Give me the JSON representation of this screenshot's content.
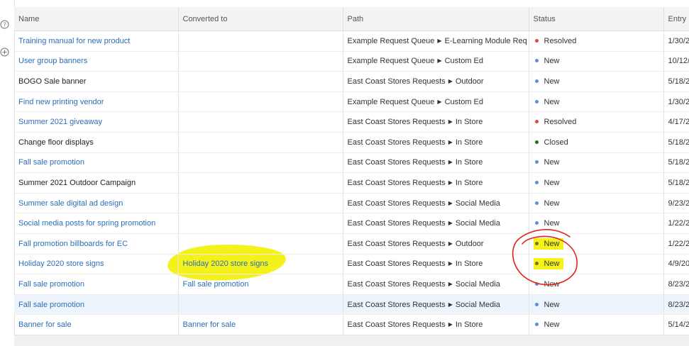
{
  "columns": {
    "name": "Name",
    "converted": "Converted to",
    "path": "Path",
    "status": "Status",
    "entry": "Entry"
  },
  "rows": [
    {
      "name": "Training manual for new product",
      "converted": "",
      "path_a": "Example Request Queue",
      "path_b": "E-Learning Module Req",
      "status": "Resolved",
      "entry": "1/30/2"
    },
    {
      "name": "User group banners",
      "converted": "",
      "path_a": "Example Request Queue",
      "path_b": "Custom Ed",
      "status": "New",
      "entry": "10/12/2"
    },
    {
      "name": "BOGO Sale banner",
      "converted": "",
      "path_a": "East Coast Stores Requests",
      "path_b": "Outdoor",
      "status": "New",
      "entry": "5/18/2"
    },
    {
      "name": "Find new printing vendor",
      "converted": "",
      "path_a": "Example Request Queue",
      "path_b": "Custom Ed",
      "status": "New",
      "entry": "1/30/2"
    },
    {
      "name": "Summer 2021 giveaway",
      "converted": "",
      "path_a": "East Coast Stores Requests",
      "path_b": "In Store",
      "status": "Resolved",
      "entry": "4/17/2"
    },
    {
      "name": "Change floor displays",
      "converted": "",
      "path_a": "East Coast Stores Requests",
      "path_b": "In Store",
      "status": "Closed",
      "entry": "5/18/2"
    },
    {
      "name": "Fall sale promotion",
      "converted": "",
      "path_a": "East Coast Stores Requests",
      "path_b": "In Store",
      "status": "New",
      "entry": "5/18/2"
    },
    {
      "name": "Summer 2021 Outdoor Campaign",
      "converted": "",
      "path_a": "East Coast Stores Requests",
      "path_b": "In Store",
      "status": "New",
      "entry": "5/18/2"
    },
    {
      "name": "Summer sale digital ad design",
      "converted": "",
      "path_a": "East Coast Stores Requests",
      "path_b": "Social Media",
      "status": "New",
      "entry": "9/23/2"
    },
    {
      "name": "Social media posts for spring promotion",
      "converted": "",
      "path_a": "East Coast Stores Requests",
      "path_b": "Social Media",
      "status": "New",
      "entry": "1/22/2"
    },
    {
      "name": "Fall promotion billboards for EC",
      "converted": "",
      "path_a": "East Coast Stores Requests",
      "path_b": "Outdoor",
      "status": "New",
      "entry": "1/22/2"
    },
    {
      "name": "Holiday 2020 store signs",
      "converted": "Holiday 2020 store signs",
      "path_a": "East Coast Stores Requests",
      "path_b": "In Store",
      "status": "New",
      "entry": "4/9/20"
    },
    {
      "name": "Fall sale promotion",
      "converted": "Fall sale promotion",
      "path_a": "East Coast Stores Requests",
      "path_b": "Social Media",
      "status": "New",
      "entry": "8/23/2"
    },
    {
      "name": "Fall sale promotion",
      "converted": "",
      "path_a": "East Coast Stores Requests",
      "path_b": "Social Media",
      "status": "New",
      "entry": "8/23/2"
    },
    {
      "name": "Banner for sale",
      "converted": "Banner for sale",
      "path_a": "East Coast Stores Requests",
      "path_b": "In Store",
      "status": "New",
      "entry": "5/14/2"
    }
  ],
  "row_meta": [
    {
      "linked": true,
      "dot_color": "#e04646"
    },
    {
      "linked": true,
      "dot_color": "#5b8fdb"
    },
    {
      "linked": false,
      "dot_color": "#5b8fdb"
    },
    {
      "linked": true,
      "dot_color": "#5b8fdb"
    },
    {
      "linked": true,
      "dot_color": "#e04646"
    },
    {
      "linked": false,
      "dot_color": "#1e6b1e"
    },
    {
      "linked": true,
      "dot_color": "#5b8fdb"
    },
    {
      "linked": false,
      "dot_color": "#5b8fdb"
    },
    {
      "linked": true,
      "dot_color": "#5b8fdb"
    },
    {
      "linked": true,
      "dot_color": "#5b8fdb"
    },
    {
      "linked": true,
      "dot_color": "#6b7a1e",
      "highlight_status": true
    },
    {
      "linked": true,
      "dot_color": "#6b7a1e",
      "highlight_status": true,
      "highlight_converted": true
    },
    {
      "linked": true,
      "dot_color": "#5b8fdb"
    },
    {
      "linked": true,
      "dot_color": "#5b8fdb",
      "selected": true
    },
    {
      "linked": true,
      "dot_color": "#5b8fdb"
    }
  ],
  "rail_icons": [
    "question-icon",
    "add-icon"
  ],
  "colors": {
    "link": "#2a6ebb",
    "highlighter": "#f4f21a",
    "annotation_red": "#e2231a"
  }
}
